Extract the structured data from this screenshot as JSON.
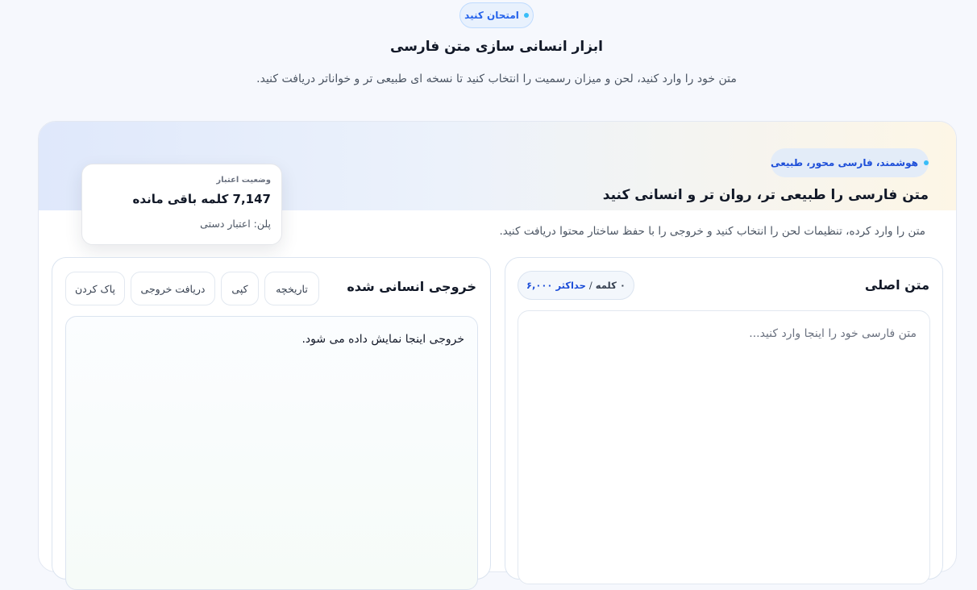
{
  "header": {
    "badge_label": "امتحان کنید",
    "title": "ابزار انسانی سازی متن فارسی",
    "subtitle": "متن خود را وارد کنید، لحن و میزان رسمیت را انتخاب کنید تا نسخه ای طبیعی تر و خواناتر دریافت کنید."
  },
  "card": {
    "feature_badge": "هوشمند، فارسی محور، طبیعی",
    "title": "متن فارسی را طبیعی تر، روان تر و انسانی کنید",
    "description": "متن را وارد کرده، تنظیمات لحن را انتخاب کنید و خروجی را با حفظ ساختار محتوا دریافت کنید."
  },
  "credit": {
    "label": "وضعیت اعتبار",
    "remaining": "7,147 کلمه باقی مانده",
    "plan": "پلن: اعتبار دستی"
  },
  "input_panel": {
    "title": "متن اصلی",
    "word_count": "۰ کلمه",
    "separator": "/",
    "max_words": "حداکثر ۶,۰۰۰",
    "placeholder": "متن فارسی خود را اینجا وارد کنید...",
    "value": ""
  },
  "output_panel": {
    "title": "خروجی انسانی شده",
    "placeholder_text": "خروجی اینجا نمایش داده می شود.",
    "buttons": {
      "history": "تاریخچه",
      "copy": "کپی",
      "download": "دریافت خروجی",
      "clear": "پاک کردن"
    }
  },
  "colors": {
    "accent": "#2563eb",
    "dot": "#38bdf8",
    "background": "#f6f8fd"
  }
}
